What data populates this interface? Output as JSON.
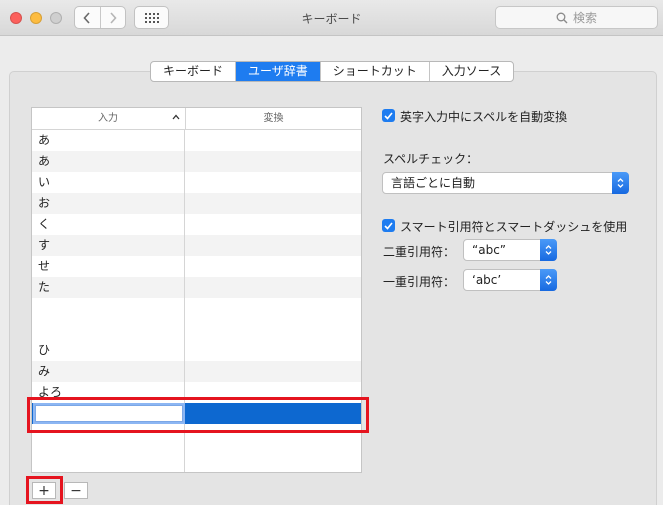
{
  "window": {
    "title": "キーボード"
  },
  "search": {
    "placeholder": "検索"
  },
  "tabs": [
    {
      "label": "キーボード",
      "active": false
    },
    {
      "label": "ユーザ辞書",
      "active": true
    },
    {
      "label": "ショートカット",
      "active": false
    },
    {
      "label": "入力ソース",
      "active": false
    }
  ],
  "table": {
    "col_input": "入力",
    "col_output": "変換",
    "rows": [
      "あ",
      "あ",
      "い",
      "お",
      "く",
      "す",
      "せ",
      "た",
      "",
      "ひ",
      "み",
      "よろ"
    ],
    "edit_value": ""
  },
  "buttons": {
    "add": "+",
    "remove": "−"
  },
  "options": {
    "autocorrect_label": "英字入力中にスペルを自動変換",
    "autocorrect_checked": true,
    "spellcheck_label": "スペルチェック：",
    "spellcheck_value": "言語ごとに自動",
    "smartquotes_label": "スマート引用符とスマートダッシュを使用",
    "smartquotes_checked": true,
    "double_quote_label": "二重引用符：",
    "double_quote_value": "“abc”",
    "single_quote_label": "一重引用符：",
    "single_quote_value": "‘abc’"
  },
  "colors": {
    "accent": "#1e7cf0",
    "selection": "#0d68d0",
    "highlight": "#e5141f"
  }
}
